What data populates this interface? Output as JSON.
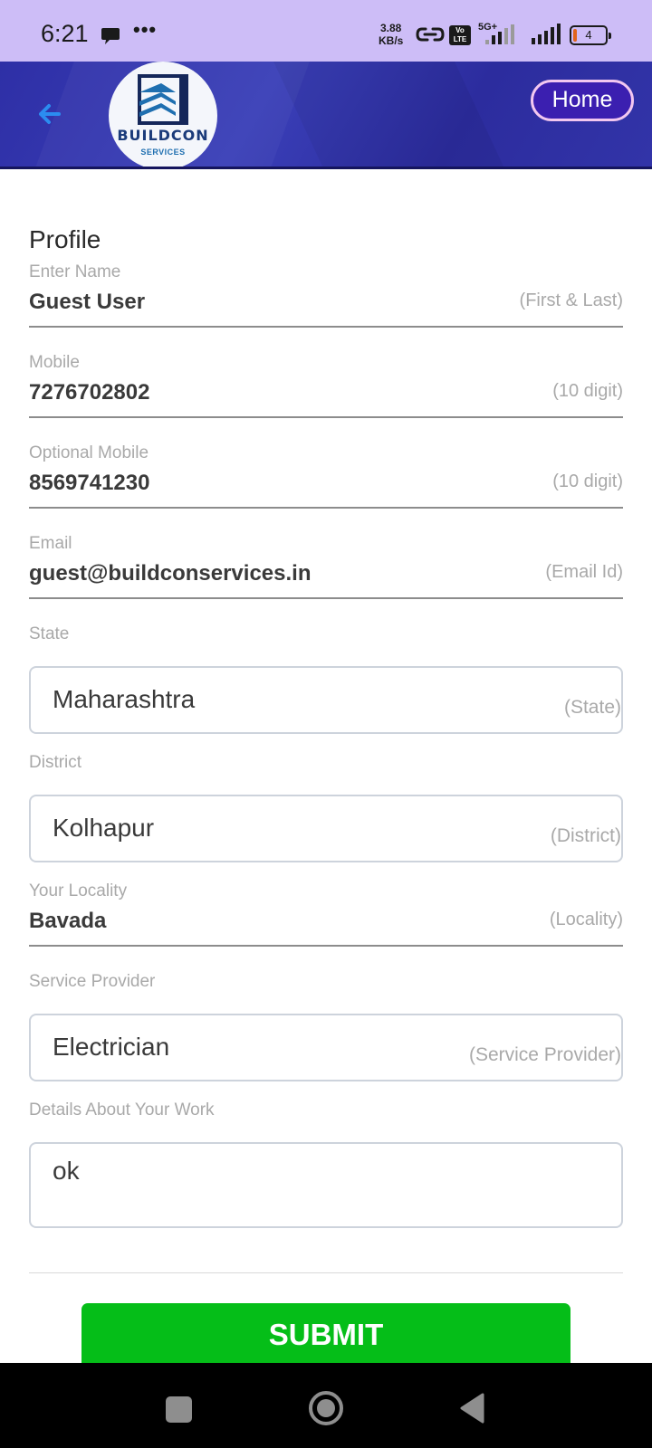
{
  "status_bar": {
    "time": "6:21",
    "net_speed_value": "3.88",
    "net_speed_unit": "KB/s",
    "volte_top": "Vo",
    "volte_bottom": "LTE",
    "network_type": "5G+",
    "battery_level": "4",
    "icons": [
      "chat-bubble-icon",
      "more-dots-icon",
      "hotspot-link-icon",
      "volte-icon",
      "signal-icon",
      "signal-icon",
      "battery-icon"
    ]
  },
  "header": {
    "logo_name": "BUILDCON",
    "logo_sub": "SERVICES",
    "home_label": "Home",
    "back_icon": "arrow-left-icon",
    "colors": {
      "header_bg": "#3236a8",
      "home_bg": "#3b1fb0",
      "home_border": "#f2c7f0",
      "back_arrow": "#2b8cf0"
    }
  },
  "form": {
    "title": "Profile",
    "name": {
      "label": "Enter Name",
      "value": "Guest User",
      "hint": "(First & Last)"
    },
    "mobile": {
      "label": "Mobile",
      "value": "7276702802",
      "hint": "(10 digit)"
    },
    "optional_mobile": {
      "label": "Optional Mobile",
      "value": "8569741230",
      "hint": "(10 digit)"
    },
    "email": {
      "label": "Email",
      "value": "guest@buildconservices.in",
      "hint": "(Email Id)"
    },
    "state": {
      "label": "State",
      "value": "Maharashtra",
      "hint": "(State)"
    },
    "district": {
      "label": "District",
      "value": "Kolhapur",
      "hint": "(District)"
    },
    "locality": {
      "label": "Your Locality",
      "value": "Bavada",
      "hint": "(Locality)"
    },
    "service_provider": {
      "label": "Service Provider",
      "value": "Electrician",
      "hint": "(Service Provider)"
    },
    "details": {
      "label": "Details About Your Work",
      "value": "ok"
    },
    "submit_label": "SUBMIT",
    "colors": {
      "submit_bg": "#05be18"
    }
  },
  "nav_bar": {
    "icons": [
      "recents-square-icon",
      "home-circle-icon",
      "back-triangle-icon"
    ]
  }
}
